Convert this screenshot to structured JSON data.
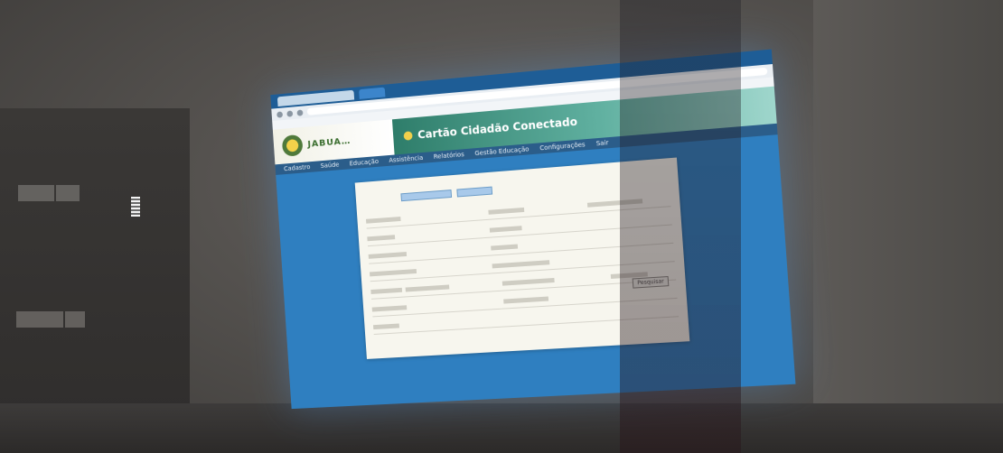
{
  "browser": {
    "tab_title": "",
    "url": ""
  },
  "portal": {
    "city_name": "JABUA…",
    "app_title": "Cartão Cidadão Conectado"
  },
  "menu": {
    "items": [
      "Cadastro",
      "Saúde",
      "Educação",
      "Assistência",
      "Relatórios",
      "Gestão Educação",
      "Configurações",
      "Sair"
    ]
  },
  "form": {
    "search_label": "Pesquisar",
    "footer_text": ""
  },
  "colors": {
    "room": "#4a4745",
    "screen_blue": "#2f7fc0",
    "banner_teal": "#2e7d6a",
    "menu_blue": "#2b5d8a",
    "panel": "#f7f6ee"
  }
}
